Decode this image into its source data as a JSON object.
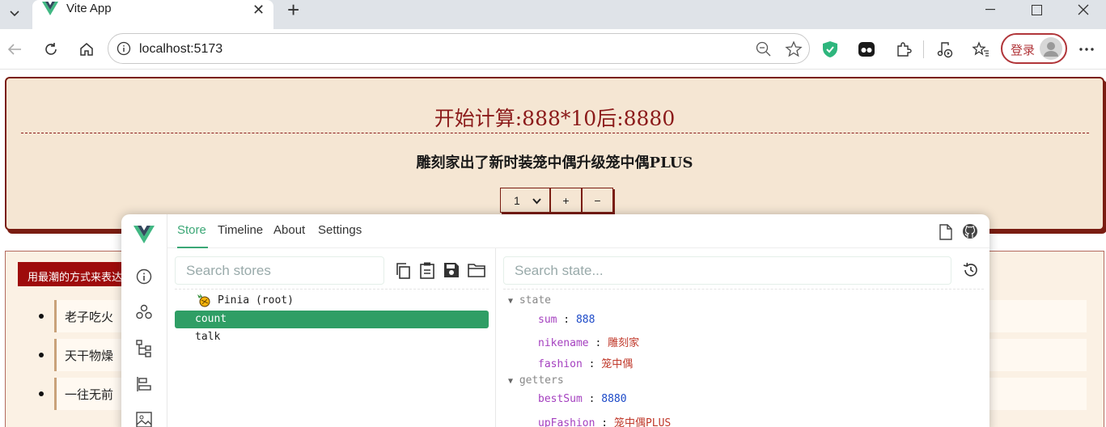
{
  "browser": {
    "tab_title": "Vite App",
    "url": "localhost:5173",
    "login_label": "登录"
  },
  "page": {
    "calc_title": "开始计算:888*10后:8880",
    "fashion_line": "雕刻家出了新时装笼中偶升级笼中偶PLUS",
    "select_value": "1",
    "plus_label": "+",
    "minus_label": "−",
    "section_label": "用最潮的方式来表达",
    "quotes": [
      "老子吃火",
      "天干物燥",
      "一往无前"
    ]
  },
  "devtools": {
    "tabs": [
      "Store",
      "Timeline",
      "About",
      "Settings"
    ],
    "search_stores_placeholder": "Search stores",
    "search_state_placeholder": "Search state...",
    "stores": [
      "Pinia (root)",
      "count",
      "talk"
    ],
    "selected_store": "count",
    "state_section": "state",
    "state": [
      {
        "key": "sum",
        "value": "888",
        "type": "num"
      },
      {
        "key": "nikename",
        "value": "雕刻家",
        "type": "str"
      },
      {
        "key": "fashion",
        "value": "笼中偶",
        "type": "str"
      }
    ],
    "getters_section": "getters",
    "getters": [
      {
        "key": "bestSum",
        "value": "8880",
        "type": "num"
      },
      {
        "key": "upFashion",
        "value": "笼中偶PLUS",
        "type": "str"
      }
    ]
  },
  "colors": {
    "accent_green": "#3ba776",
    "brand_red": "#8b1a1a",
    "card_bg": "#f5e6d3"
  }
}
